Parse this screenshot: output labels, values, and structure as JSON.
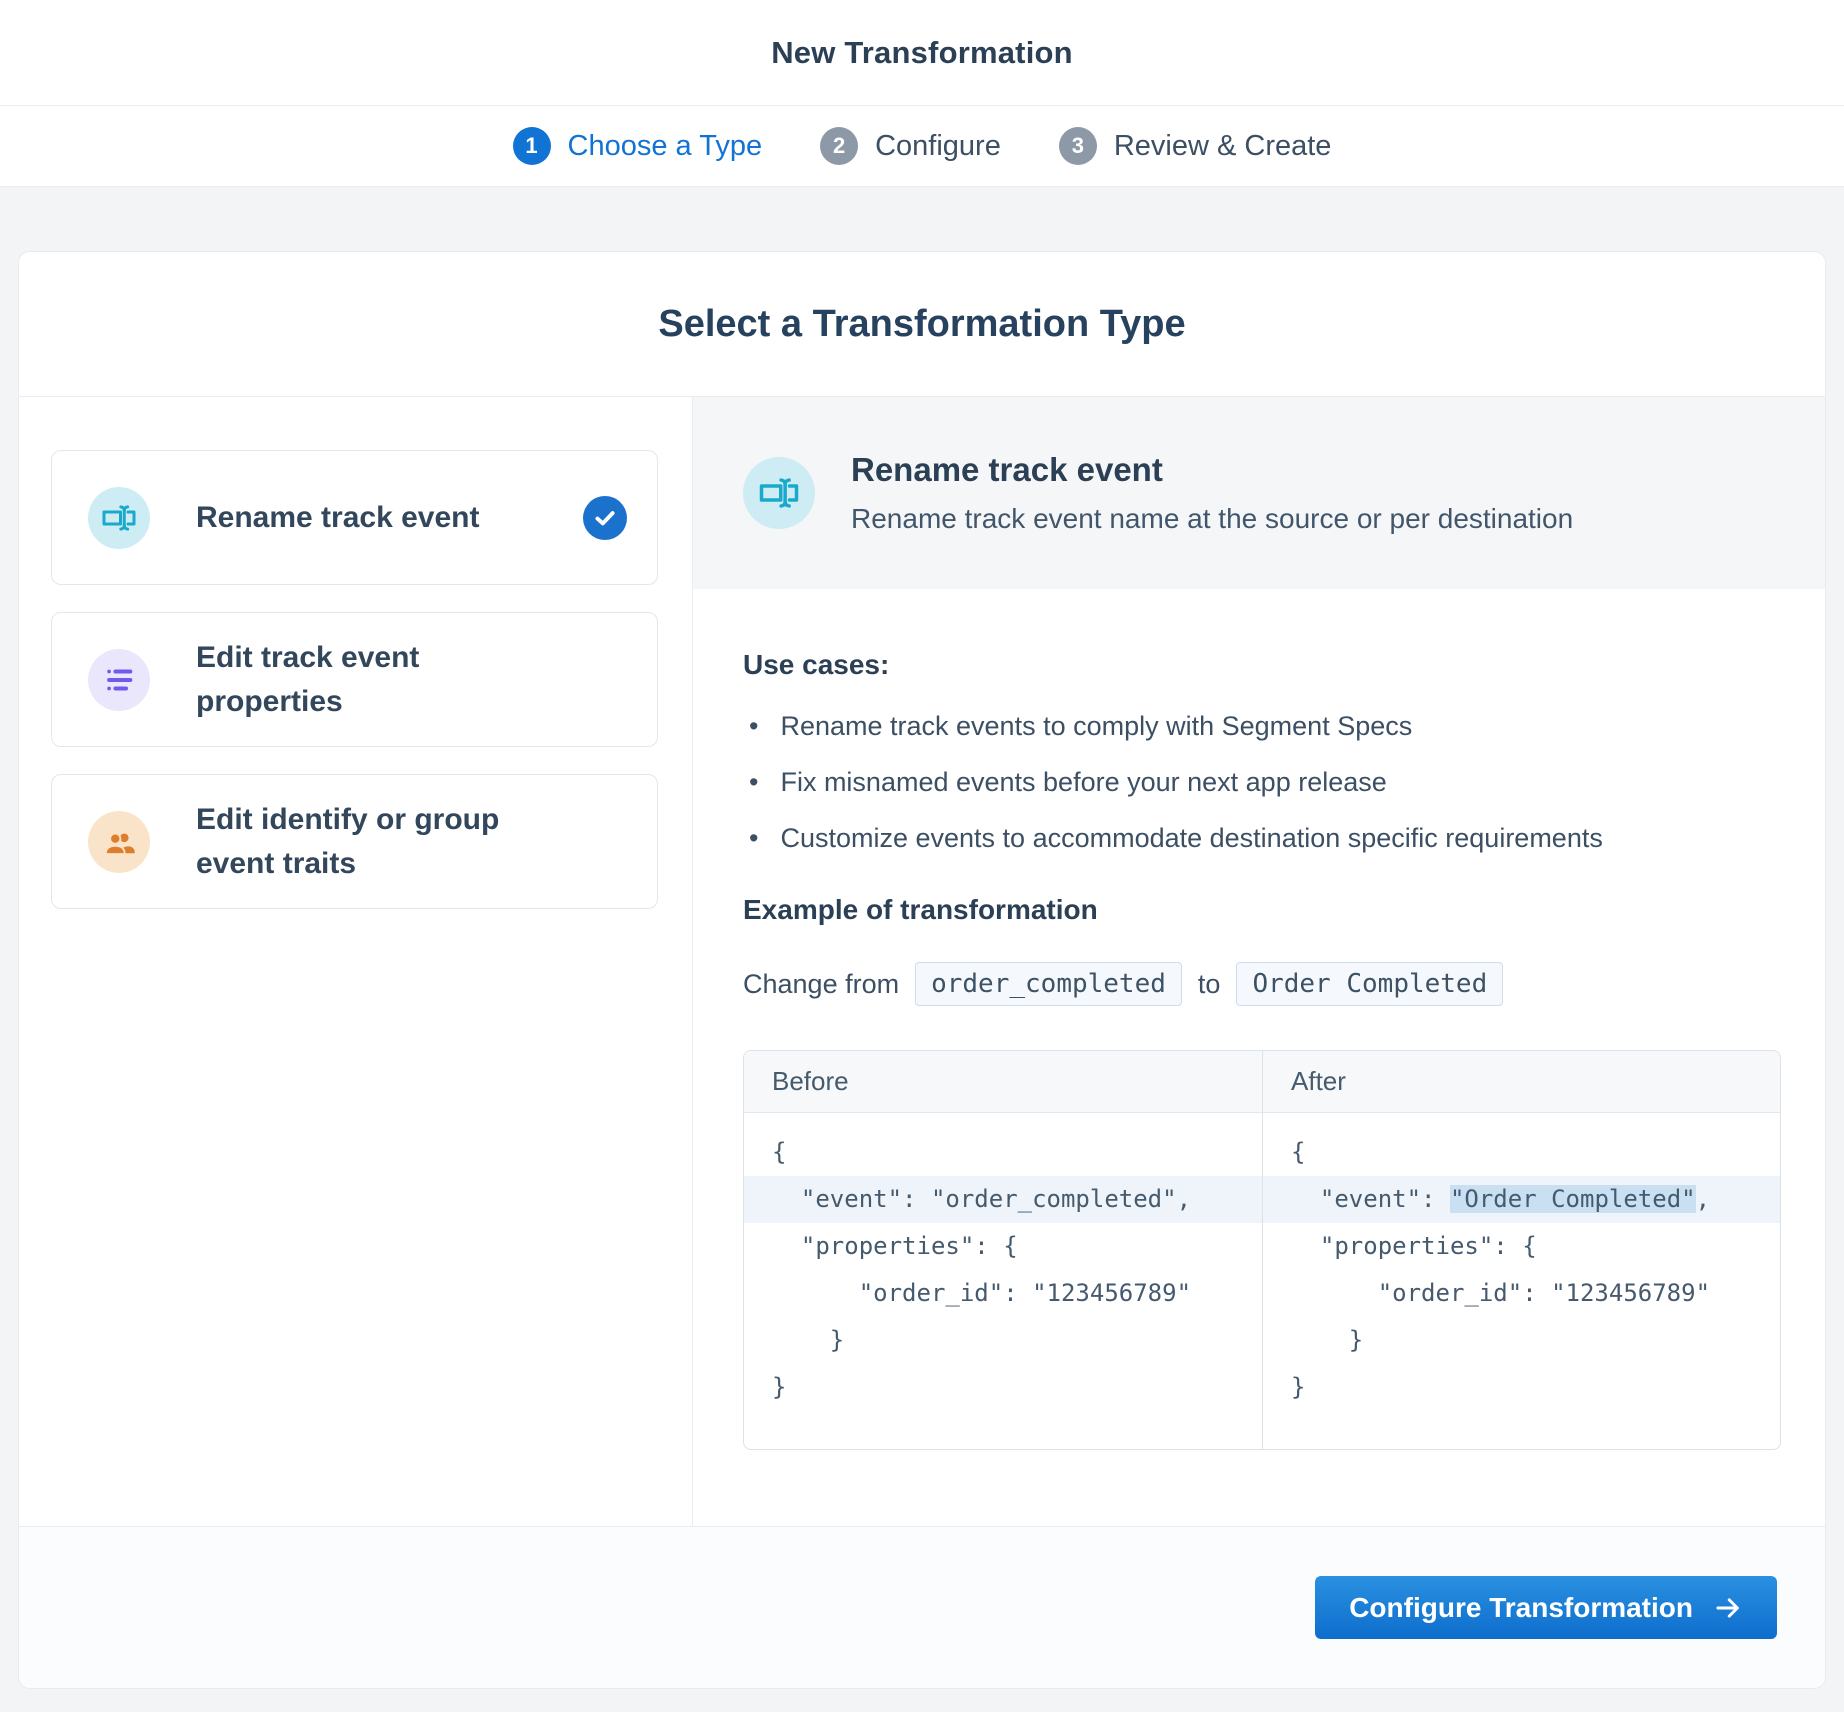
{
  "header": {
    "title": "New Transformation"
  },
  "stepper": {
    "steps": [
      {
        "number": "1",
        "label": "Choose a Type",
        "active": true
      },
      {
        "number": "2",
        "label": "Configure",
        "active": false
      },
      {
        "number": "3",
        "label": "Review & Create",
        "active": false
      }
    ]
  },
  "panel": {
    "title": "Select a Transformation Type"
  },
  "options": [
    {
      "label": "Rename track event",
      "icon": "rename-icon",
      "selected": true
    },
    {
      "label": "Edit track event properties",
      "icon": "list-icon",
      "selected": false
    },
    {
      "label": "Edit identify or group event traits",
      "icon": "people-icon",
      "selected": false
    }
  ],
  "detail": {
    "title": "Rename track event",
    "description": "Rename track event name at the source or per destination",
    "use_cases_heading": "Use cases:",
    "use_cases": [
      "Rename track events to comply with Segment Specs",
      "Fix misnamed events before your next app release",
      "Customize events to accommodate destination specific requirements"
    ],
    "example_heading": "Example of transformation",
    "change_from_label": "Change from",
    "change_from_value": "order_completed",
    "to_label": "to",
    "to_value": "Order Completed",
    "table": {
      "before": {
        "header": "Before",
        "lines": [
          "{",
          "  \"event\": \"order_completed\",",
          "  \"properties\": {",
          "      \"order_id\": \"123456789\"",
          "    }",
          "}"
        ]
      },
      "after": {
        "header": "After",
        "line_open": "{",
        "event_prefix": "  \"event\": ",
        "event_highlight": "\"Order Completed\"",
        "event_suffix": ",",
        "lines_rest": [
          "  \"properties\": {",
          "      \"order_id\": \"123456789\"",
          "    }",
          "}"
        ]
      }
    }
  },
  "footer": {
    "button_label": "Configure Transformation"
  },
  "colors": {
    "accent_blue": "#1173d4",
    "step_inactive_gray": "#8d99a6",
    "heading_navy": "#2b3f55",
    "body_text": "#3c4f63",
    "teal_icon": "#1ba9cb",
    "teal_icon_bg": "#cdecf4",
    "purple_icon": "#6f5aeb",
    "purple_icon_bg": "#eae6fc",
    "orange_icon": "#de7e2d",
    "orange_icon_bg": "#f9e4c9",
    "check_circle": "#1b72cc",
    "highlight_row": "#eef4f9",
    "highlight_token": "#c9dff2",
    "button_gradient_top": "#2a90e0",
    "button_gradient_bottom": "#0d6ecd",
    "page_bg": "#f2f4f6",
    "detail_header_bg": "#f5f6f8"
  }
}
